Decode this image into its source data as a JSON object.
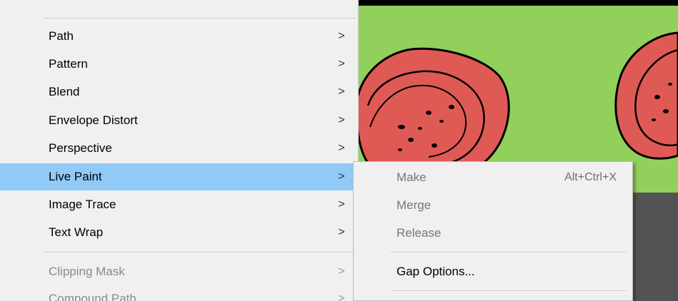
{
  "colors": {
    "artboard": "#92d05c",
    "pasteboard": "#535353",
    "menu_bg": "#f0f0f0",
    "highlight": "#91c9f7",
    "fruit_fill": "#e05a55"
  },
  "object_menu": {
    "items": [
      {
        "label": "Path",
        "arrow": ">",
        "state": "normal"
      },
      {
        "label": "Pattern",
        "arrow": ">",
        "state": "normal"
      },
      {
        "label": "Blend",
        "arrow": ">",
        "state": "normal"
      },
      {
        "label": "Envelope Distort",
        "arrow": ">",
        "state": "normal"
      },
      {
        "label": "Perspective",
        "arrow": ">",
        "state": "normal"
      },
      {
        "label": "Live Paint",
        "arrow": ">",
        "state": "highlighted"
      },
      {
        "label": "Image Trace",
        "arrow": ">",
        "state": "normal"
      },
      {
        "label": "Text Wrap",
        "arrow": ">",
        "state": "normal"
      },
      {
        "label": "Clipping Mask",
        "arrow": ">",
        "state": "disabled"
      },
      {
        "label": "Compound Path",
        "arrow": ">",
        "state": "disabled"
      }
    ]
  },
  "live_paint_submenu": {
    "items": [
      {
        "label": "Make",
        "shortcut": "Alt+Ctrl+X",
        "state": "disabled"
      },
      {
        "label": "Merge",
        "shortcut": "",
        "state": "disabled"
      },
      {
        "label": "Release",
        "shortcut": "",
        "state": "disabled"
      },
      {
        "label": "Gap Options...",
        "shortcut": "",
        "state": "normal"
      }
    ]
  }
}
